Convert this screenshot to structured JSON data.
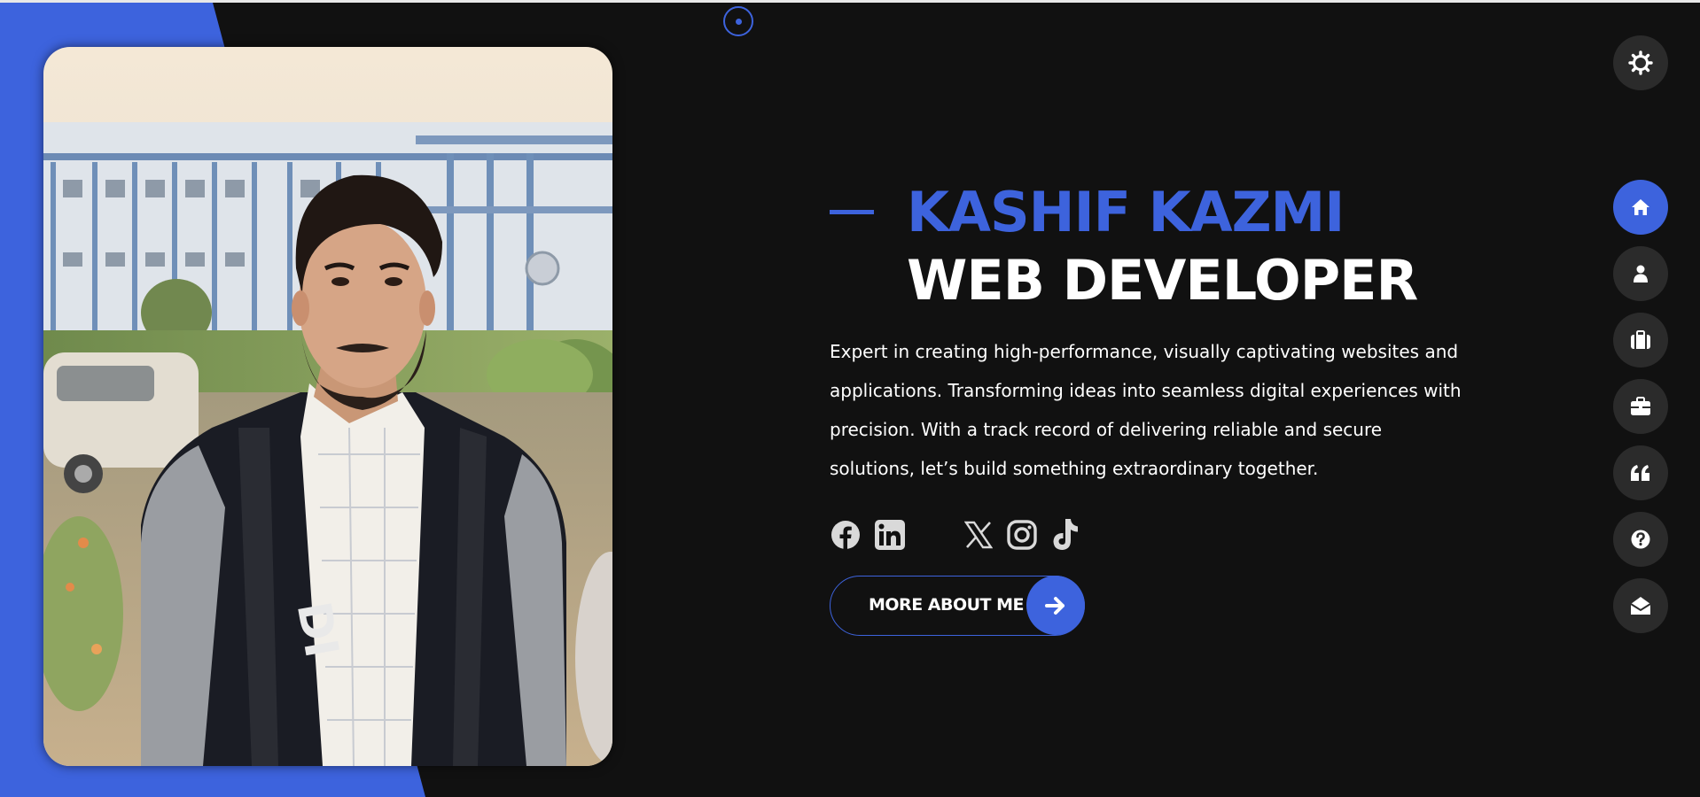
{
  "theme": {
    "accent": "#3d63dd",
    "background": "#111111",
    "button_bg": "#2b2b2b",
    "text": "#ffffff"
  },
  "hero": {
    "name": "KASHIF KAZMI",
    "role": "WEB DEVELOPER",
    "bio": "Expert in creating high-performance, visually captivating websites and applications. Transforming ideas into seamless digital experiences with precision. With a track record of delivering reliable and secure solutions, let’s build something extraordinary together.",
    "photo_icon": "portrait-photo"
  },
  "socials": [
    {
      "name": "facebook",
      "icon": "facebook-icon"
    },
    {
      "name": "linkedin",
      "icon": "linkedin-icon"
    },
    {
      "name": "x",
      "icon": "x-twitter-icon"
    },
    {
      "name": "instagram",
      "icon": "instagram-icon"
    },
    {
      "name": "tiktok",
      "icon": "tiktok-icon"
    }
  ],
  "cta": {
    "label": "MORE ABOUT ME",
    "icon": "arrow-right-icon"
  },
  "settings": {
    "icon": "gear-icon"
  },
  "nav": [
    {
      "id": "home",
      "icon": "home-icon",
      "active": true
    },
    {
      "id": "about",
      "icon": "user-icon",
      "active": false
    },
    {
      "id": "portfolio",
      "icon": "suitcase-icon",
      "active": false
    },
    {
      "id": "services",
      "icon": "briefcase-icon",
      "active": false
    },
    {
      "id": "testimonials",
      "icon": "quote-icon",
      "active": false
    },
    {
      "id": "faq",
      "icon": "question-icon",
      "active": false
    },
    {
      "id": "contact",
      "icon": "envelope-open-icon",
      "active": false
    }
  ]
}
